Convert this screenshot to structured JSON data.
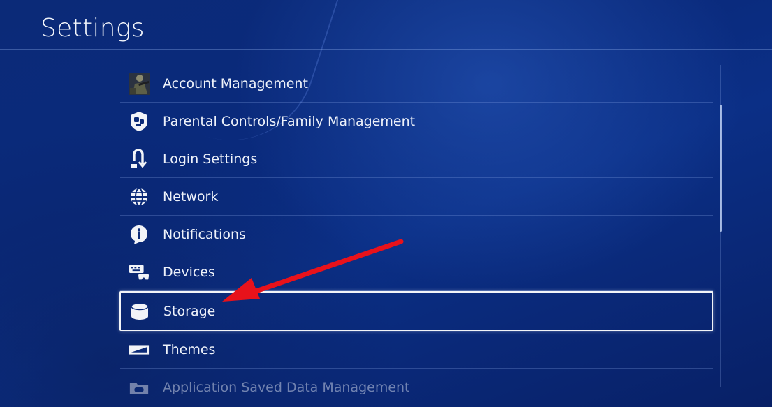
{
  "header": {
    "title": "Settings"
  },
  "menu": {
    "items": [
      {
        "label": "Account Management",
        "icon": "avatar-icon"
      },
      {
        "label": "Parental Controls/Family Management",
        "icon": "parental-controls-icon"
      },
      {
        "label": "Login Settings",
        "icon": "login-icon"
      },
      {
        "label": "Network",
        "icon": "globe-icon"
      },
      {
        "label": "Notifications",
        "icon": "info-icon"
      },
      {
        "label": "Devices",
        "icon": "keyboard-controller-icon"
      },
      {
        "label": "Storage",
        "icon": "database-icon",
        "selected": true
      },
      {
        "label": "Themes",
        "icon": "monitor-theme-icon"
      },
      {
        "label": "Application Saved Data Management",
        "icon": "saved-data-icon"
      }
    ]
  },
  "annotation": {
    "color": "#e8121b"
  },
  "colors": {
    "background": "#0a2a7c",
    "accent": "#f2f4f8"
  }
}
